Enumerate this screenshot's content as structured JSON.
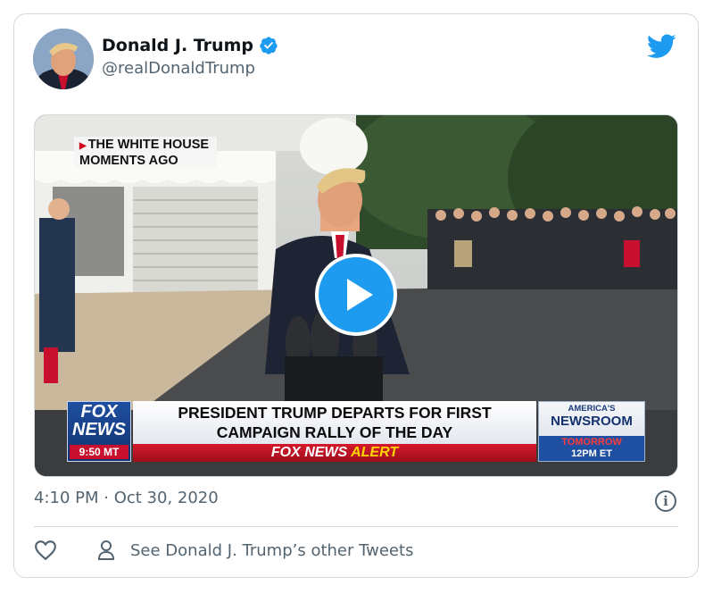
{
  "tweet": {
    "author_name": "Donald J. Trump",
    "author_handle": "@realDonaldTrump",
    "timestamp": "4:10 PM · Oct 30, 2020",
    "footer_link": "See Donald J. Trump’s other Tweets"
  },
  "video": {
    "slug_line1": "THE WHITE HOUSE",
    "slug_line2": "MOMENTS AGO",
    "logo_line1": "FOX",
    "logo_line2": "NEWS",
    "clock": "9:50 MT",
    "headline_line1": "PRESIDENT TRUMP DEPARTS FOR FIRST",
    "headline_line2": "CAMPAIGN RALLY OF THE DAY",
    "alert_brand": "FOX NEWS",
    "alert_word": "ALERT",
    "promo_line1": "AMERICA'S",
    "promo_line2": "NEWSROOM",
    "promo_line3": "TOMORROW",
    "promo_line4": "12PM ET"
  },
  "icons": {
    "verified": "verified-badge-icon",
    "twitter": "twitter-bird-icon",
    "play": "play-icon",
    "info": "info-icon",
    "like": "heart-icon",
    "profile": "person-icon"
  },
  "colors": {
    "brand_blue": "#1d9bf0",
    "secondary_text": "#536471",
    "border": "#cfd9de",
    "fox_red": "#c8102e"
  }
}
